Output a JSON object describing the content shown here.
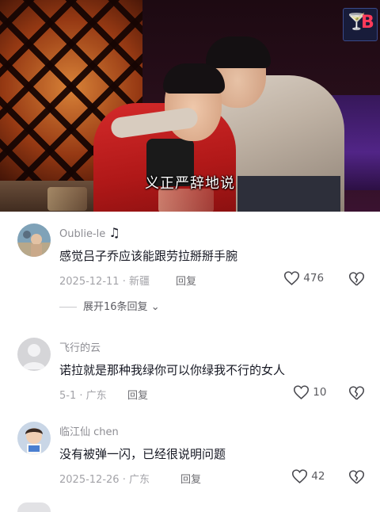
{
  "video": {
    "subtitle": "义正严辞地说",
    "channel_logo_icon": "wine-glass-icon",
    "channel_logo_letter": "B"
  },
  "comments": [
    {
      "username": "Oublie-le",
      "username_badge": "music-note-icon",
      "text": "感觉吕子乔应该能跟劳拉掰掰手腕",
      "date": "2025-12-11",
      "location": "新疆",
      "reply_label": "回复",
      "likes": "476",
      "expand_label": "展开16条回复"
    },
    {
      "username": "飞行的云",
      "text": "诺拉就是那种我绿你可以你绿我不行的女人",
      "date": "5-1",
      "location": "广东",
      "reply_label": "回复",
      "likes": "10"
    },
    {
      "username": "临江仙 chen",
      "text": "没有被弹一闪，已经很说明问题",
      "date": "2025-12-26",
      "location": "广东",
      "reply_label": "回复",
      "likes": "42"
    }
  ],
  "colors": {
    "text_primary": "#161823",
    "text_secondary": "#8d8d93",
    "background": "#ffffff"
  }
}
